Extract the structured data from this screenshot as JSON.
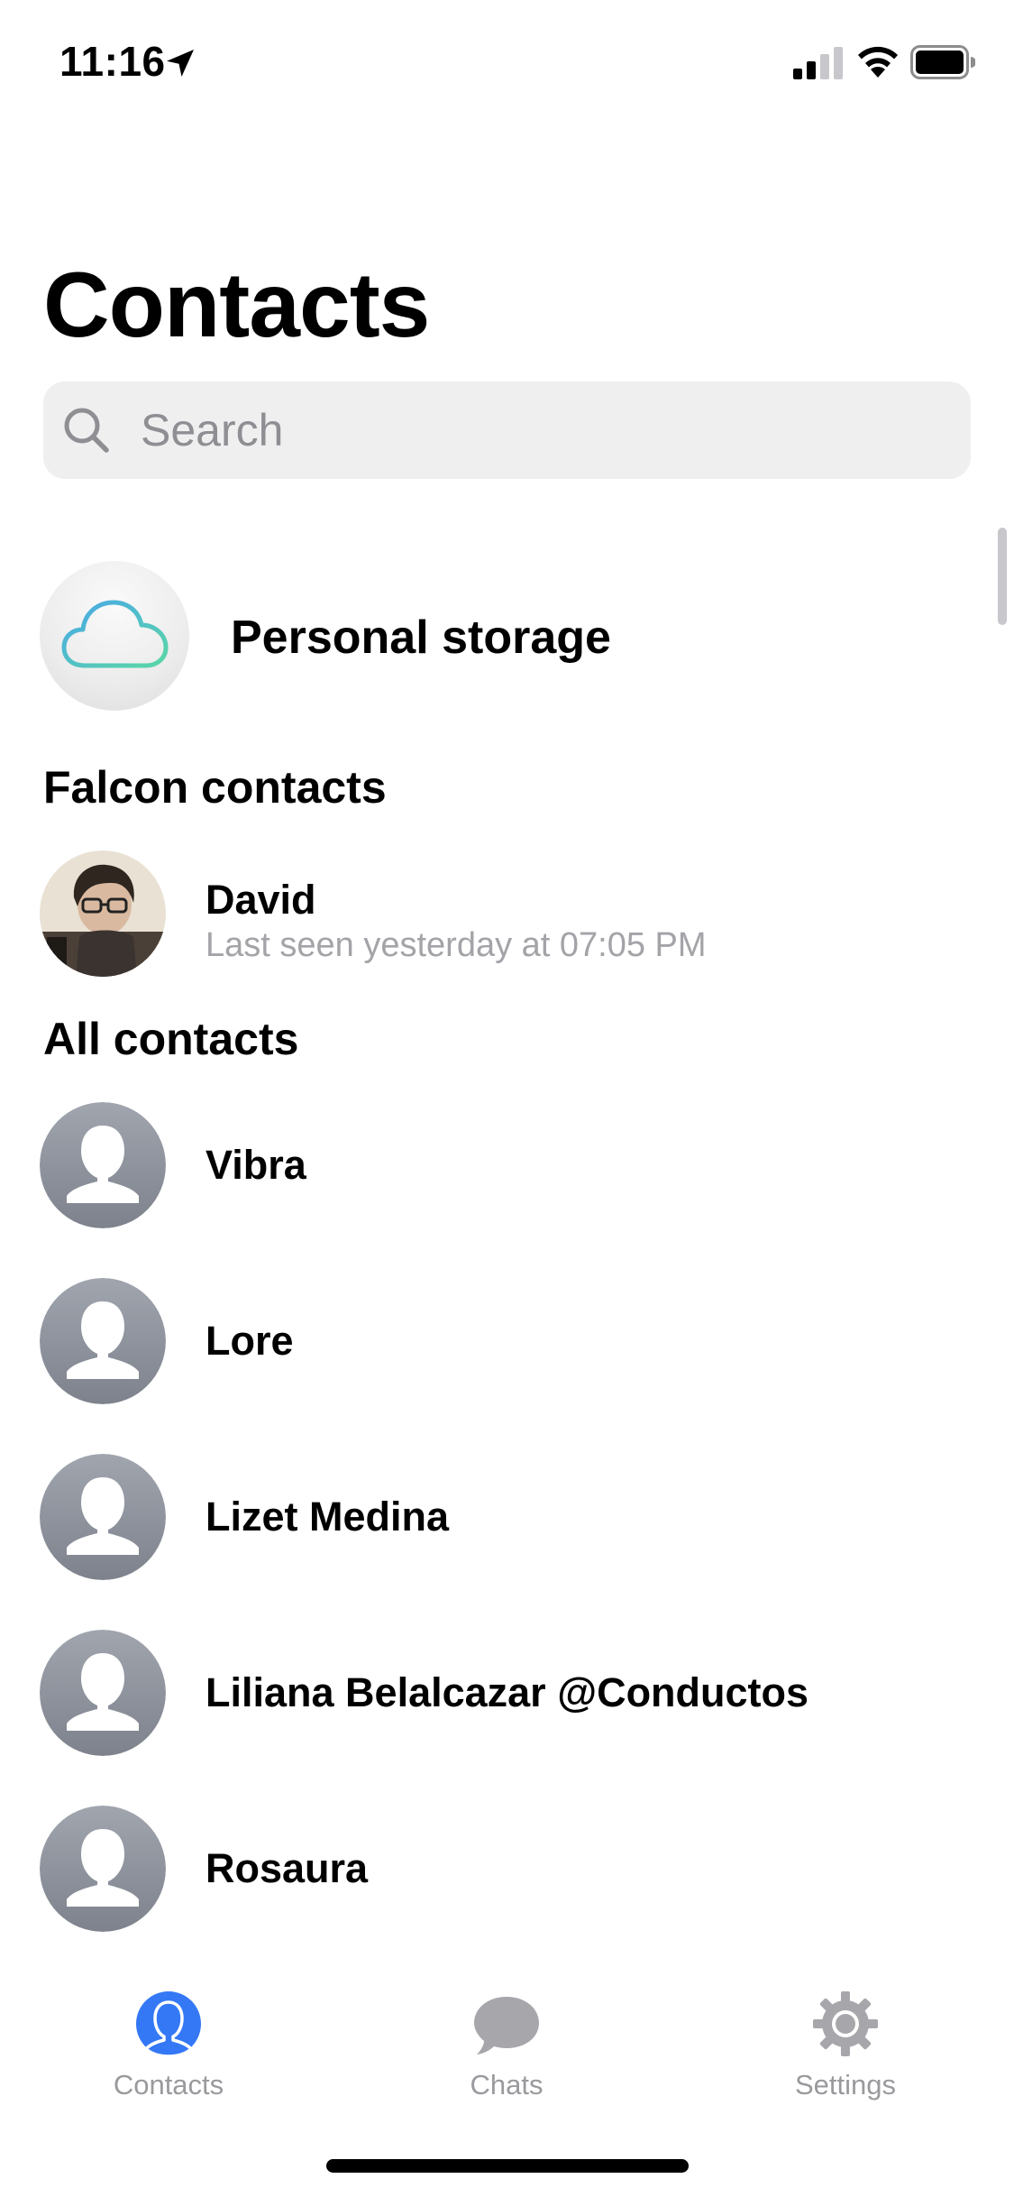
{
  "status_bar": {
    "time": "11:16",
    "icons": [
      "location-arrow-icon",
      "cellular-signal-icon",
      "wifi-icon",
      "battery-icon"
    ]
  },
  "page": {
    "title": "Contacts"
  },
  "search": {
    "placeholder": "Search",
    "icon": "search-icon"
  },
  "personal_storage": {
    "label": "Personal storage",
    "icon": "cloud-icon"
  },
  "falcon_contacts": {
    "header": "Falcon contacts",
    "items": [
      {
        "name": "David",
        "status": "Last seen yesterday at 07:05 PM",
        "avatar": "photo"
      }
    ]
  },
  "all_contacts": {
    "header": "All contacts",
    "items": [
      {
        "name": "Vibra"
      },
      {
        "name": "Lore"
      },
      {
        "name": "Lizet Medina"
      },
      {
        "name": "Liliana Belalcazar @Conductos"
      },
      {
        "name": "Rosaura"
      }
    ]
  },
  "tab_bar": {
    "tabs": [
      {
        "label": "Contacts",
        "icon": "contacts-icon",
        "active": true
      },
      {
        "label": "Chats",
        "icon": "chat-bubble-icon",
        "active": false
      },
      {
        "label": "Settings",
        "icon": "gear-icon",
        "active": false
      }
    ]
  },
  "colors": {
    "accent": "#3478f6",
    "inactive_tab": "#9a9a9e",
    "placeholder_avatar": "#8a8f99",
    "search_bg": "#efeff0"
  }
}
